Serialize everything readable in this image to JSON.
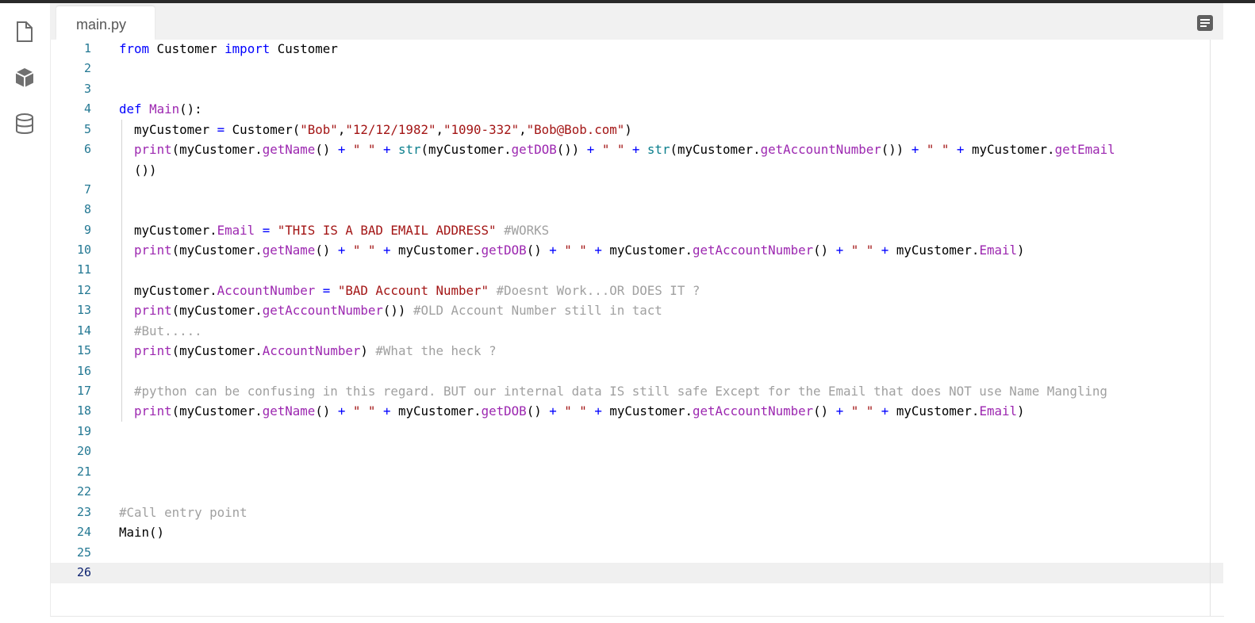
{
  "editor": {
    "tab_label": "main.py",
    "line_numbers": [
      "1",
      "2",
      "3",
      "4",
      "5",
      "6",
      "7",
      "8",
      "9",
      "10",
      "11",
      "12",
      "13",
      "14",
      "15",
      "16",
      "17",
      "18",
      "19",
      "20",
      "21",
      "22",
      "23",
      "24",
      "25",
      "26"
    ]
  },
  "sidebar": {
    "icons": [
      "file-icon",
      "package-icon",
      "database-icon"
    ]
  },
  "code_lines": [
    "from Customer import Customer",
    "",
    "",
    "def Main():",
    "  myCustomer = Customer(\"Bob\",\"12/12/1982\",\"1090-332\",\"Bob@Bob.com\")",
    "  print(myCustomer.getName() + \" \" + str(myCustomer.getDOB()) + \" \" + str(myCustomer.getAccountNumber()) + \" \" + myCustomer.getEmail",
    "  ())",
    "",
    "",
    "  myCustomer.Email = \"THIS IS A BAD EMAIL ADDRESS\" #WORKS",
    "  print(myCustomer.getName() + \" \" + myCustomer.getDOB() + \" \" + myCustomer.getAccountNumber() + \" \" + myCustomer.Email)",
    "",
    "  myCustomer.AccountNumber = \"BAD Account Number\" #Doesnt Work...OR DOES IT ?",
    "  print(myCustomer.getAccountNumber()) #OLD Account Number still in tact",
    "  #But.....",
    "  print(myCustomer.AccountNumber) #What the heck ?",
    "",
    "  #python can be confusing in this regard. BUT our internal data IS still safe Except for the Email that does NOT use Name Mangling",
    "  print(myCustomer.getName() + \" \" + myCustomer.getDOB() + \" \" + myCustomer.getAccountNumber() + \" \" + myCustomer.Email)",
    "",
    "",
    "",
    "",
    "#Call entry point",
    "Main()",
    "",
    ""
  ]
}
